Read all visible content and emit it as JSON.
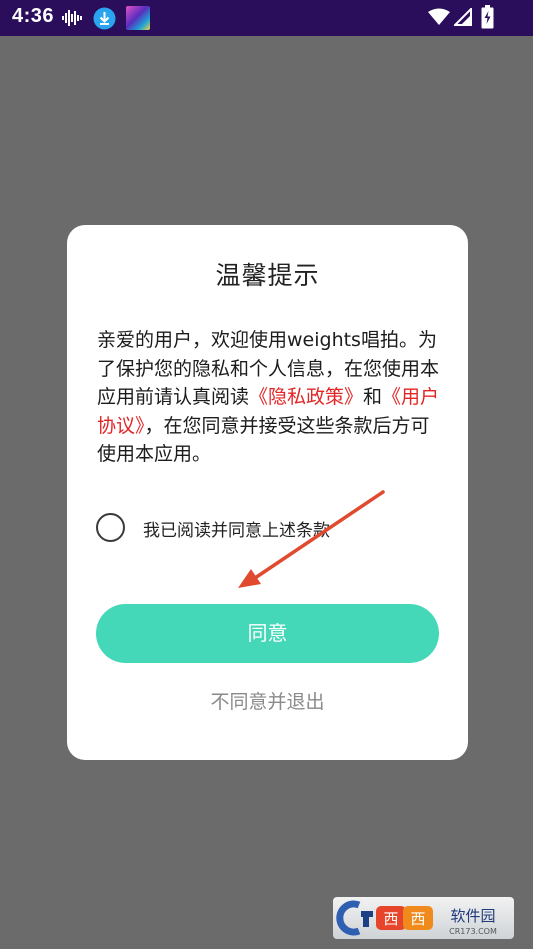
{
  "status_bar": {
    "time": "4:36",
    "icons": [
      "soundwave-icon",
      "download-icon",
      "app-icon",
      "wifi-icon",
      "signal-icon",
      "battery-icon"
    ]
  },
  "dialog": {
    "title": "温馨提示",
    "body_prefix": "亲爱的用户，欢迎使用weights唱拍。为了保护您的隐私和个人信息，在您使用本应用前请认真阅读",
    "privacy_link": "《隐私政策》",
    "and_text": "和",
    "agreement_link": "《用户协议》",
    "body_suffix": "，在您同意并接受这些条款后方可使用本应用。",
    "consent_label": "我已阅读并同意上述条款",
    "consent_checked": false,
    "agree_label": "同意",
    "decline_label": "不同意并退出"
  },
  "colors": {
    "status_bar_bg": "#2a0e5c",
    "backdrop": "#6b6b6b",
    "link": "#e32525",
    "agree_button": "#44d8b8",
    "annotation_arrow": "#e04a2e"
  },
  "watermark": {
    "brand": "西西软件园",
    "domain": "CR173.COM"
  }
}
